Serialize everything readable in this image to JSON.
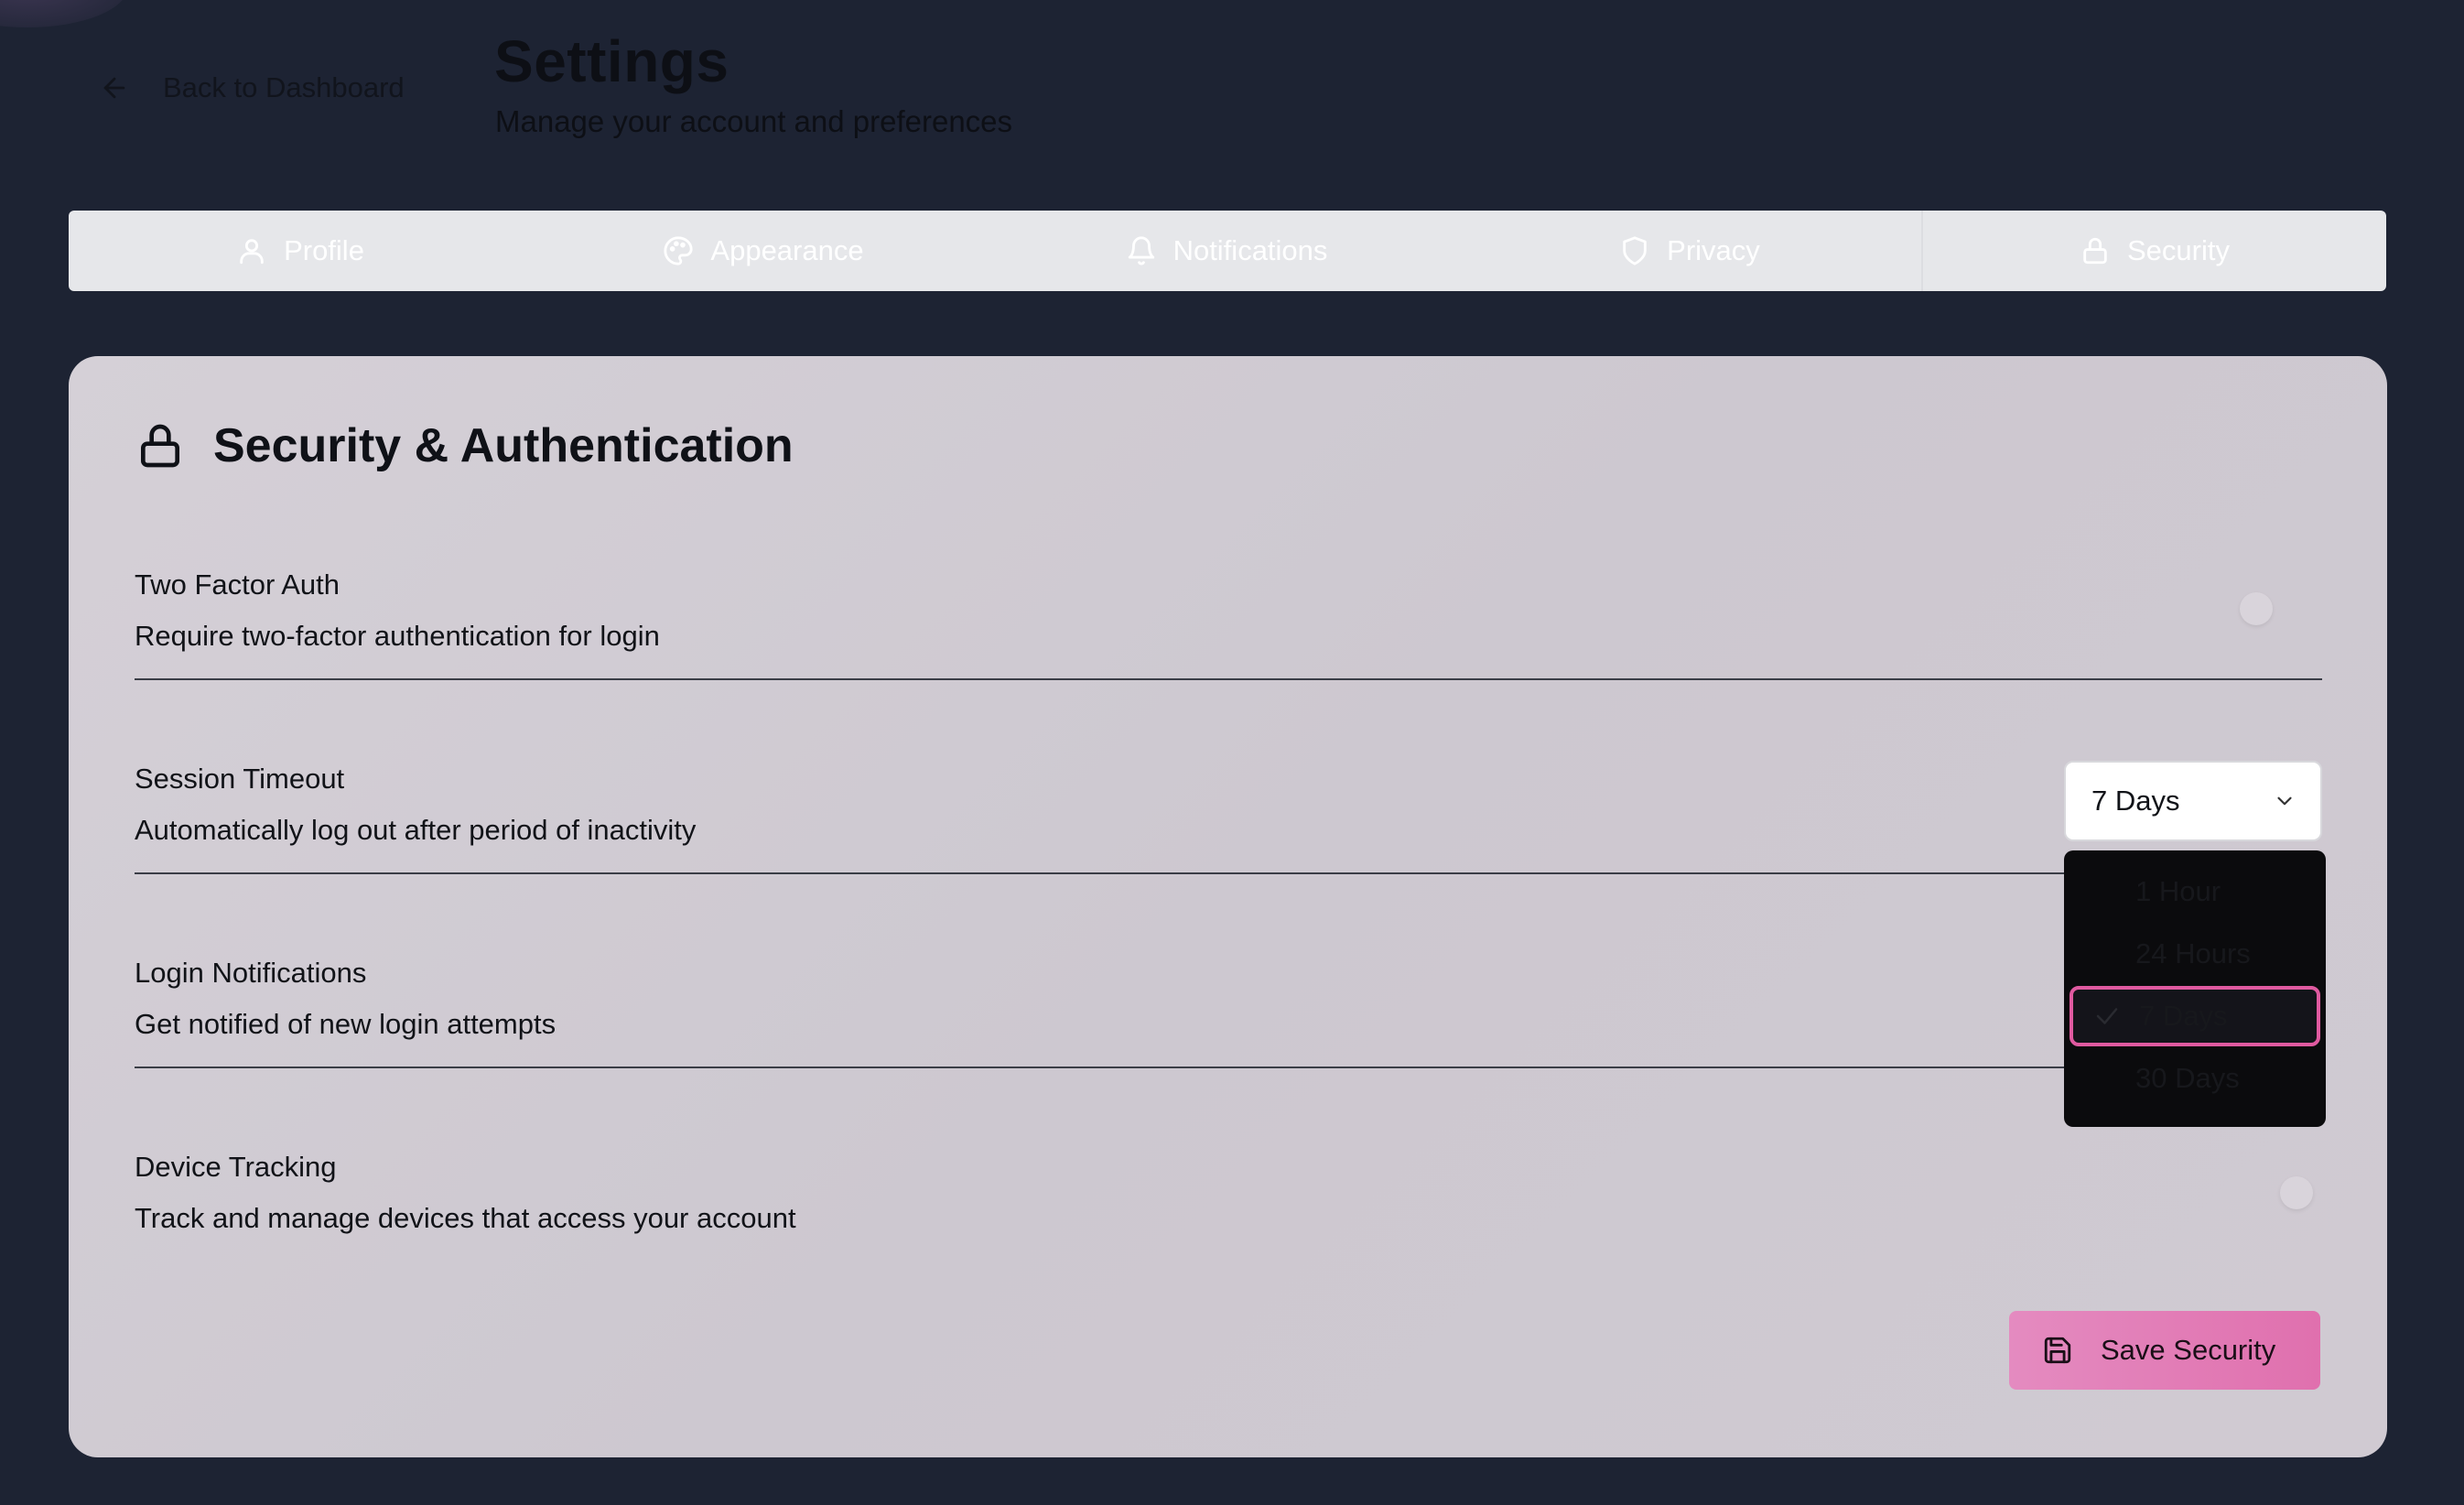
{
  "header": {
    "back_label": "Back to Dashboard",
    "title": "Settings",
    "subtitle": "Manage your account and preferences"
  },
  "tabs": [
    {
      "label": "Profile",
      "icon": "user-icon"
    },
    {
      "label": "Appearance",
      "icon": "palette-icon"
    },
    {
      "label": "Notifications",
      "icon": "bell-icon"
    },
    {
      "label": "Privacy",
      "icon": "shield-icon"
    },
    {
      "label": "Security",
      "icon": "lock-icon",
      "active": true
    }
  ],
  "section": {
    "title": "Security & Authentication",
    "icon": "lock-icon"
  },
  "settings": {
    "two_factor": {
      "label": "Two Factor Auth",
      "description": "Require two-factor authentication for login"
    },
    "session_timeout": {
      "label": "Session Timeout",
      "description": "Automatically log out after period of inactivity",
      "selected": "7 Days",
      "options": [
        "1 Hour",
        "24 Hours",
        "7 Days",
        "30 Days"
      ]
    },
    "login_notifications": {
      "label": "Login Notifications",
      "description": "Get notified of new login attempts"
    },
    "device_tracking": {
      "label": "Device Tracking",
      "description": "Track and manage devices that access your account"
    }
  },
  "save_button": {
    "label": "Save Security",
    "icon": "save-icon"
  },
  "colors": {
    "background": "#1d2333",
    "card": "#d0cbd3",
    "accent": "#e070ae",
    "dropdown": "#0b0b0d"
  }
}
